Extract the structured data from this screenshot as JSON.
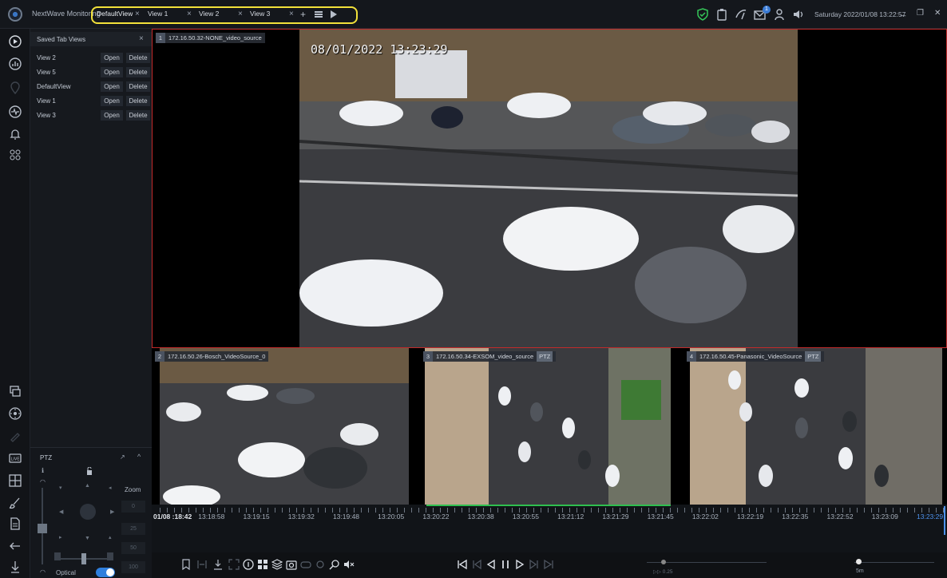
{
  "app": {
    "title": "NextWave Monitoring"
  },
  "tabs": [
    {
      "label": "DefaultView",
      "active": true
    },
    {
      "label": "View 1",
      "active": false
    },
    {
      "label": "View 2",
      "active": false
    },
    {
      "label": "View 3",
      "active": false
    }
  ],
  "tab_close_glyph": "×",
  "tab_add_glyph": "+",
  "notification_count": "1",
  "datetime": "Saturday 2022/01/08 13:22:57",
  "window_controls": {
    "minimize": "_",
    "restore": "❐",
    "close": "✕"
  },
  "saved_views": {
    "title": "Saved Tab Views",
    "close": "×",
    "open_label": "Open",
    "delete_label": "Delete",
    "items": [
      "View 2",
      "View 5",
      "DefaultView",
      "View 1",
      "View 3"
    ]
  },
  "ptz": {
    "title": "PTZ",
    "expand": "↗",
    "collapse": "^",
    "zoom_label": "Zoom",
    "zoom_values": [
      "0",
      "25",
      "50",
      "100"
    ],
    "optical_label": "Optical",
    "optical_on": true
  },
  "cameras": [
    {
      "num": "1",
      "label": "172.16.50.32-NONE_video_source",
      "ptz": false,
      "osd": "08/01/2022 13:23:29"
    },
    {
      "num": "2",
      "label": "172.16.50.26-Bosch_VideoSource_0",
      "ptz": false,
      "osd": ""
    },
    {
      "num": "3",
      "label": "172.16.50.34-EXSOM_video_source",
      "ptz": true,
      "osd": ""
    },
    {
      "num": "4",
      "label": "172.16.50.45-Panasonic_VideoSource",
      "ptz": true,
      "osd": ""
    }
  ],
  "ptz_tag": "PTZ",
  "timeline": {
    "labels": [
      "01/08 :18:42",
      "13:18:58",
      "13:19:15",
      "13:19:32",
      "13:19:48",
      "13:20:05",
      "13:20:22",
      "13:20:38",
      "13:20:55",
      "13:21:12",
      "13:21:29",
      "13:21:45",
      "13:22:02",
      "13:22:19",
      "13:22:35",
      "13:22:52",
      "13:23:09",
      "13:23:29"
    ]
  },
  "playback": {
    "speed": "0.25",
    "speed_label": "▷▷ 0.25",
    "range": "5m"
  },
  "colors": {
    "accent": "#2f7fdd",
    "tab_highlight": "#f2e13a",
    "selected_border": "#c22a2a",
    "recording": "#2fbf4f"
  }
}
